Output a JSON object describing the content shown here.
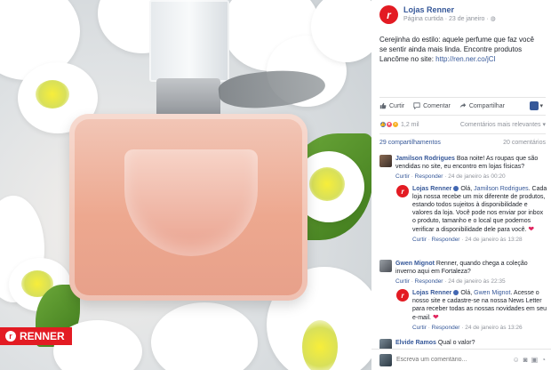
{
  "photo": {
    "brand_tag": "RENNER"
  },
  "post": {
    "page_name": "Lojas Renner",
    "page_meta": "Página curtida · 23 de janeiro · ",
    "text": "Cerejinha do estilo: aquele perfume que faz você se sentir ainda mais linda. Encontre produtos Lancôme no site: ",
    "link": "http://ren.ner.co/jCI",
    "actions": {
      "like": "Curtir",
      "comment": "Comentar",
      "share": "Compartilhar"
    },
    "reactions_count": "1,2 mil",
    "sort_label": "Comentários mais relevantes ▾",
    "shares_label": "29 compartilhamentos",
    "comments_label": "20 comentários"
  },
  "comments": [
    {
      "author": "Jamilson Rodrigues",
      "text": " Boa noite! As roupas que são vendidas no site, eu encontro em lojas físicas?",
      "like": "Curtir",
      "reply": "Responder",
      "time": "24 de janeiro às 00:20"
    },
    {
      "author": "Lojas Renner",
      "tag": "Jamilson Rodrigues",
      "text_pre": "Olá, ",
      "text": ". Cada loja nossa recebe um mix diferente de produtos, estando todos sujeitos à disponibilidade e valores da loja. Você pode nos enviar por inbox o produto, tamanho e o local que podemos verificar a disponibilidade dele para você. ",
      "heart": "❤",
      "like": "Curtir",
      "reply": "Responder",
      "time": "24 de janeiro às 13:28"
    },
    {
      "author": "Gwen Mignot",
      "text": " Renner, quando chega a coleção inverno aqui em Fortaleza?",
      "like": "Curtir",
      "reply": "Responder",
      "time": "24 de janeiro às 22:35"
    },
    {
      "author": "Lojas Renner",
      "tag": "Gwen Mignot",
      "text_pre": "Olá, ",
      "text": ". Acesse o nosso site e cadastre-se na nossa News Letter para receber todas as nossas novidades em seu e-mail. ",
      "heart": "❤",
      "like": "Curtir",
      "reply": "Responder",
      "time": "24 de janeiro às 13:26"
    },
    {
      "author": "Elvide Ramos",
      "text": " Qual o valor?"
    }
  ],
  "composer": {
    "placeholder": "Escreva um comentário..."
  }
}
